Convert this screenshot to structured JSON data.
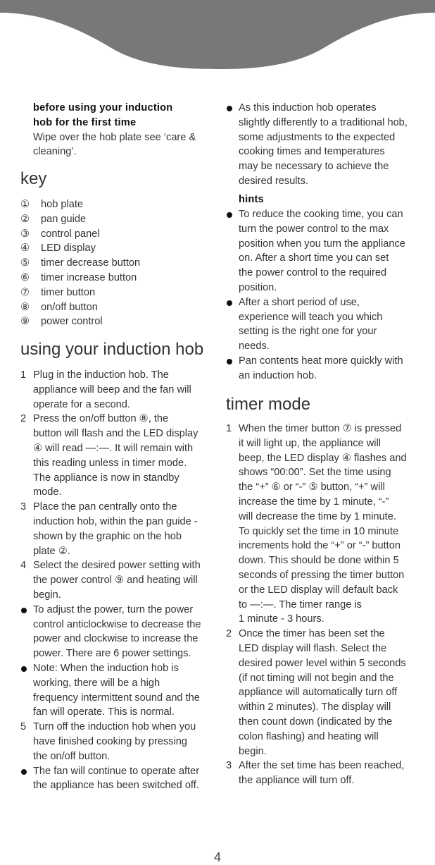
{
  "colors": {
    "banner": "#77787a",
    "text": "#333333"
  },
  "left_column": {
    "intro": {
      "heading": "before using your induction hob for the first time",
      "heading_line1": "before using your induction",
      "heading_line2": "hob for the first time",
      "body_line1": "Wipe over the hob plate see ‘care &",
      "body_line2": "cleaning’."
    },
    "key": {
      "title": "key",
      "items": [
        {
          "num": "①",
          "label": "hob plate"
        },
        {
          "num": "②",
          "label": "pan guide"
        },
        {
          "num": "③",
          "label": "control panel"
        },
        {
          "num": "④",
          "label": "LED display"
        },
        {
          "num": "⑤",
          "label": "timer decrease button"
        },
        {
          "num": "⑥",
          "label": "timer increase button"
        },
        {
          "num": "⑦",
          "label": "timer button"
        },
        {
          "num": "⑧",
          "label": "on/off button"
        },
        {
          "num": "⑨",
          "label": "power control"
        }
      ]
    },
    "using": {
      "title": "using your induction hob",
      "steps": [
        {
          "marker": "1",
          "type": "number",
          "lines": [
            "Plug in the induction hob. The",
            "appliance will beep and the fan will",
            "operate for a second."
          ]
        },
        {
          "marker": "2",
          "type": "number",
          "lines": [
            "Press the on/off button ⑧, the",
            "button will flash and the LED display",
            "④ will read —:—. It will remain with",
            "this reading unless in timer mode.",
            "The appliance is now in standby",
            "mode."
          ]
        },
        {
          "marker": "3",
          "type": "number",
          "lines": [
            "Place the pan centrally onto the",
            "induction hob, within the pan guide -",
            "shown by the graphic on the hob",
            "plate ②."
          ]
        },
        {
          "marker": "4",
          "type": "number",
          "lines": [
            "Select the desired power setting with",
            "the power control ⑨ and heating will",
            "begin."
          ]
        },
        {
          "marker": "•",
          "type": "bullet",
          "lines": [
            "To adjust the power, turn the power",
            "control anticlockwise to decrease the",
            "power and clockwise to increase the",
            "power. There are 6 power settings."
          ]
        },
        {
          "marker": "•",
          "type": "bullet",
          "lines": [
            "Note: When the induction hob is",
            "working, there will be a high",
            "frequency intermittent sound and the",
            "fan will operate. This is normal."
          ]
        },
        {
          "marker": "5",
          "type": "number",
          "lines": [
            "Turn off the induction hob when you",
            "have finished cooking by pressing",
            "the on/off button."
          ]
        },
        {
          "marker": "•",
          "type": "bullet",
          "lines": [
            "The fan will continue to operate after",
            "the appliance has been switched off."
          ]
        }
      ]
    }
  },
  "right_column": {
    "intro_bullet": {
      "lines": [
        "As this induction hob operates",
        "slightly differently to a traditional hob,",
        "some adjustments to the expected",
        "cooking times and temperatures",
        "may be necessary to achieve the",
        "desired results."
      ]
    },
    "hints": {
      "title": "hints",
      "items": [
        {
          "lines": [
            "To reduce the cooking time, you can",
            "turn the power control to the max",
            "position when you turn the appliance",
            "on. After a short time you can set",
            "the power control to the required",
            "position."
          ]
        },
        {
          "lines": [
            "After a short period of use,",
            "experience will teach you which",
            "setting is the right one for your",
            "needs."
          ]
        },
        {
          "lines": [
            "Pan contents heat more quickly with",
            "an induction hob."
          ]
        }
      ]
    },
    "timer": {
      "title": "timer mode",
      "steps": [
        {
          "marker": "1",
          "lines": [
            "When the timer button ⑦ is pressed",
            "it will light up, the appliance will",
            "beep, the LED display ④ flashes and",
            "shows “00:00”. Set the time using",
            "the “+” ⑥ or “-” ⑤ button, “+” will",
            "increase the time by 1 minute, “-”",
            "will decrease the time by 1 minute.",
            "To quickly set the time in 10 minute",
            "increments hold the “+” or “-” button",
            "down. This should be done within 5",
            "seconds of pressing the timer button",
            "or the LED display will default back",
            "to —:—. The timer range is",
            "1 minute - 3 hours."
          ]
        },
        {
          "marker": "2",
          "lines": [
            "Once the timer has been set the",
            "LED display will flash. Select the",
            "desired power level within 5 seconds",
            "(if not timing will not begin and the",
            "appliance will automatically turn off",
            "within 2 minutes). The display will",
            "then count down (indicated by the",
            "colon flashing) and heating will",
            "begin."
          ]
        },
        {
          "marker": "3",
          "lines": [
            "After the set time has been reached,",
            "the appliance will turn off."
          ]
        }
      ]
    }
  },
  "footer": {
    "page_number": "4"
  }
}
